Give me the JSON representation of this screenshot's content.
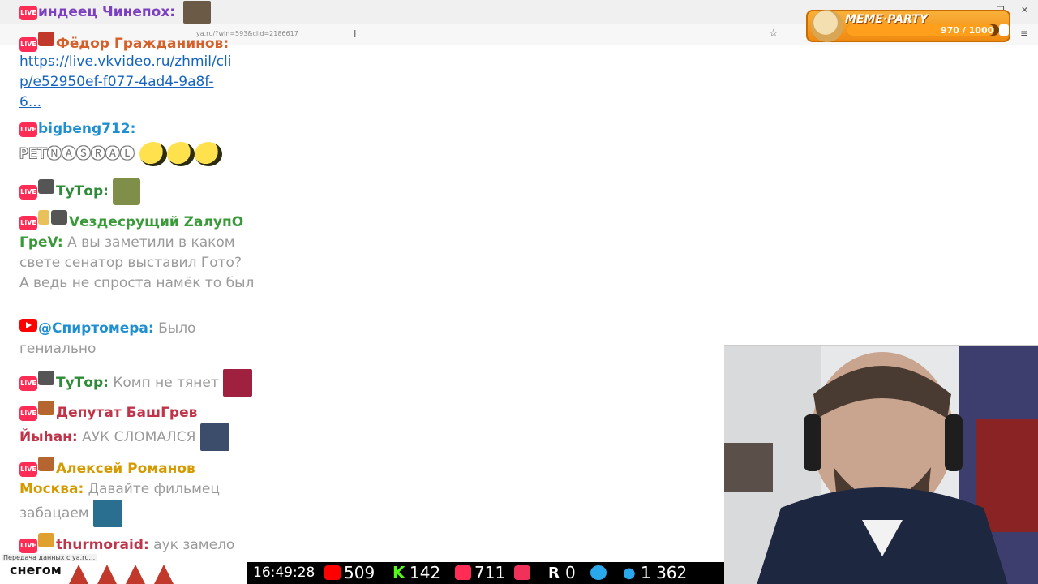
{
  "browser": {
    "url": "ya.ru/?win=593&clid=2186617",
    "status": "Передача данных с ya.ru..."
  },
  "meme_party": {
    "title": "MEME·PARTY",
    "progress_text": "970 / 1000",
    "progress": 0.97
  },
  "chat": {
    "messages": [
      {
        "platform": "live",
        "user": "индеец Чинепох:",
        "text": ""
      },
      {
        "platform": "live",
        "user": "Фёдор Гражданинов:",
        "text": "https://live.vkvideo.ru/zhmil/clip/e52950ef-f077-4ad4-9a8f-6..."
      },
      {
        "platform": "live",
        "user": "bigbeng712:",
        "text": "PET🅝🅐🅢🅡🅐🅛"
      },
      {
        "platform": "live",
        "user": "ТуТор:",
        "text": ""
      },
      {
        "platform": "live",
        "user": "Vездесрущий ZалупО ГреV:",
        "text": "А вы заметили в каком свете сенатор выставил Гото? А ведь не спроста намёк то был"
      },
      {
        "platform": "youtube",
        "user": "@Спиртомера:",
        "text": "Было гениально"
      },
      {
        "platform": "live",
        "user": "ТуТор:",
        "text": "Комп не тянет"
      },
      {
        "platform": "live",
        "user": "Депутат БашГрев Йыhан:",
        "text": "АУК СЛОМАЛСЯ"
      },
      {
        "platform": "live",
        "user": "Алексей Романов Москва:",
        "text": "Давайте фильмец забацаем"
      },
      {
        "platform": "live",
        "user": "thurmoraid:",
        "text": "аук замело"
      }
    ],
    "link_lines": [
      "https://live.vkvideo.ru/zhmil/cli",
      "p/e52950ef-f077-4ad4-9a8f-",
      "6..."
    ]
  },
  "stats": {
    "snow_label": "снегом",
    "time": "16:49:28",
    "youtube": "509",
    "kick": "142",
    "vklive": "711",
    "rutube": "0",
    "r": "0",
    "telegram": "1 362"
  },
  "colors": {
    "live": "#ff2d55",
    "youtube": "#ff0000",
    "kick": "#53fc18",
    "telegram": "#29a9eb",
    "meme_orange": "#f39c1f"
  }
}
